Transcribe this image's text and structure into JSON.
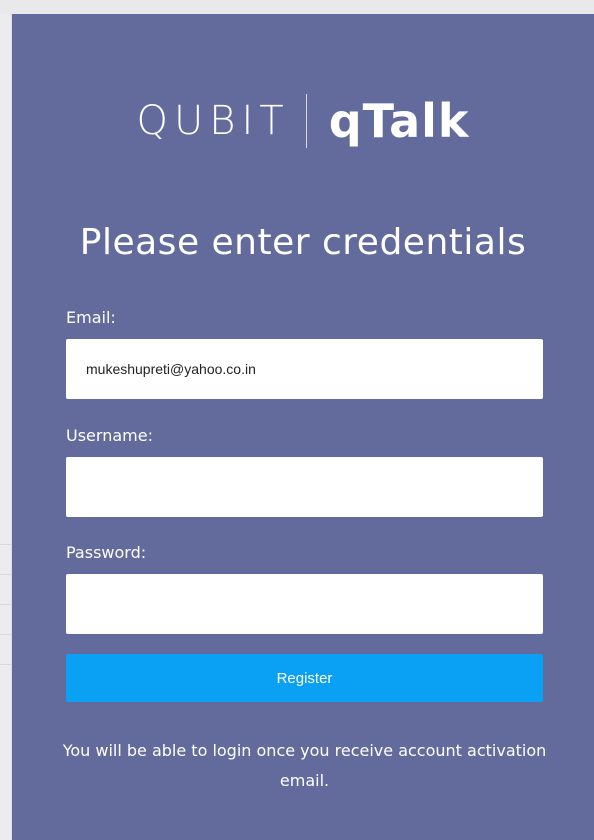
{
  "logo": {
    "brand": "QUBIT",
    "product": "qTalk"
  },
  "heading": "Please enter credentials",
  "form": {
    "email": {
      "label": "Email:",
      "value": "mukeshupreti@yahoo.co.in"
    },
    "username": {
      "label": "Username:",
      "value": ""
    },
    "password": {
      "label": "Password:",
      "value": ""
    },
    "register_label": "Register"
  },
  "note": "You will be able to login once you receive account activation email.",
  "colors": {
    "panel": "#636b9c",
    "button": "#0aa1f5",
    "text": "#ffffff"
  }
}
